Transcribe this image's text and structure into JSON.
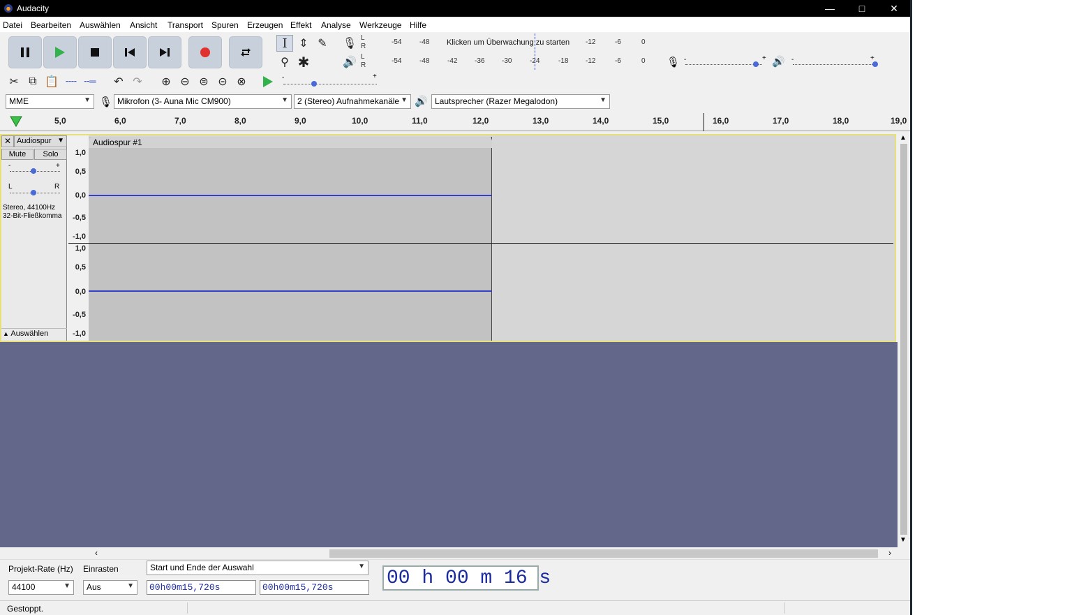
{
  "window": {
    "title": "Audacity"
  },
  "menu": [
    "Datei",
    "Bearbeiten",
    "Auswählen",
    "Ansicht",
    "Transport",
    "Spuren",
    "Erzeugen",
    "Effekt",
    "Analyse",
    "Werkzeuge",
    "Hilfe"
  ],
  "meters": {
    "rec_scale": [
      "-54",
      "-48",
      "-12",
      "-6",
      "0"
    ],
    "rec_hint": "Klicken um Überwachung zu starten",
    "play_scale": [
      "-54",
      "-48",
      "-42",
      "-36",
      "-30",
      "-24",
      "-18",
      "-12",
      "-6",
      "0"
    ],
    "channel_l": "L",
    "channel_r": "R"
  },
  "devices": {
    "host": "MME",
    "mic": "Mikrofon (3- Auna Mic CM900)",
    "channels": "2 (Stereo) Aufnahmekanäle",
    "speaker": "Lautsprecher (Razer Megalodon)"
  },
  "ruler": {
    "labels": [
      "5,0",
      "6,0",
      "7,0",
      "8,0",
      "9,0",
      "10,0",
      "11,0",
      "12,0",
      "13,0",
      "14,0",
      "15,0",
      "16,0",
      "17,0",
      "18,0",
      "19,0"
    ]
  },
  "track": {
    "name": "Audiospur",
    "clip_name": "Audiospur #1",
    "mute": "Mute",
    "solo": "Solo",
    "gain_minus": "-",
    "gain_plus": "+",
    "pan_l": "L",
    "pan_r": "R",
    "info_line1": "Stereo, 44100Hz",
    "info_line2": "32-Bit-Fließkomma",
    "select": "Auswählen",
    "scale": [
      "1,0",
      "0,5",
      "0,0",
      "-0,5",
      "-1,0"
    ]
  },
  "selection_bar": {
    "rate_label": "Projekt-Rate (Hz)",
    "rate_value": "44100",
    "snap_label": "Einrasten",
    "snap_value": "Aus",
    "mode": "Start und Ende der Auswahl",
    "start": "00h00m15,720s",
    "end": "00h00m15,720s",
    "audio_position": "00 h 00 m 16 s"
  },
  "status": "Gestoppt."
}
